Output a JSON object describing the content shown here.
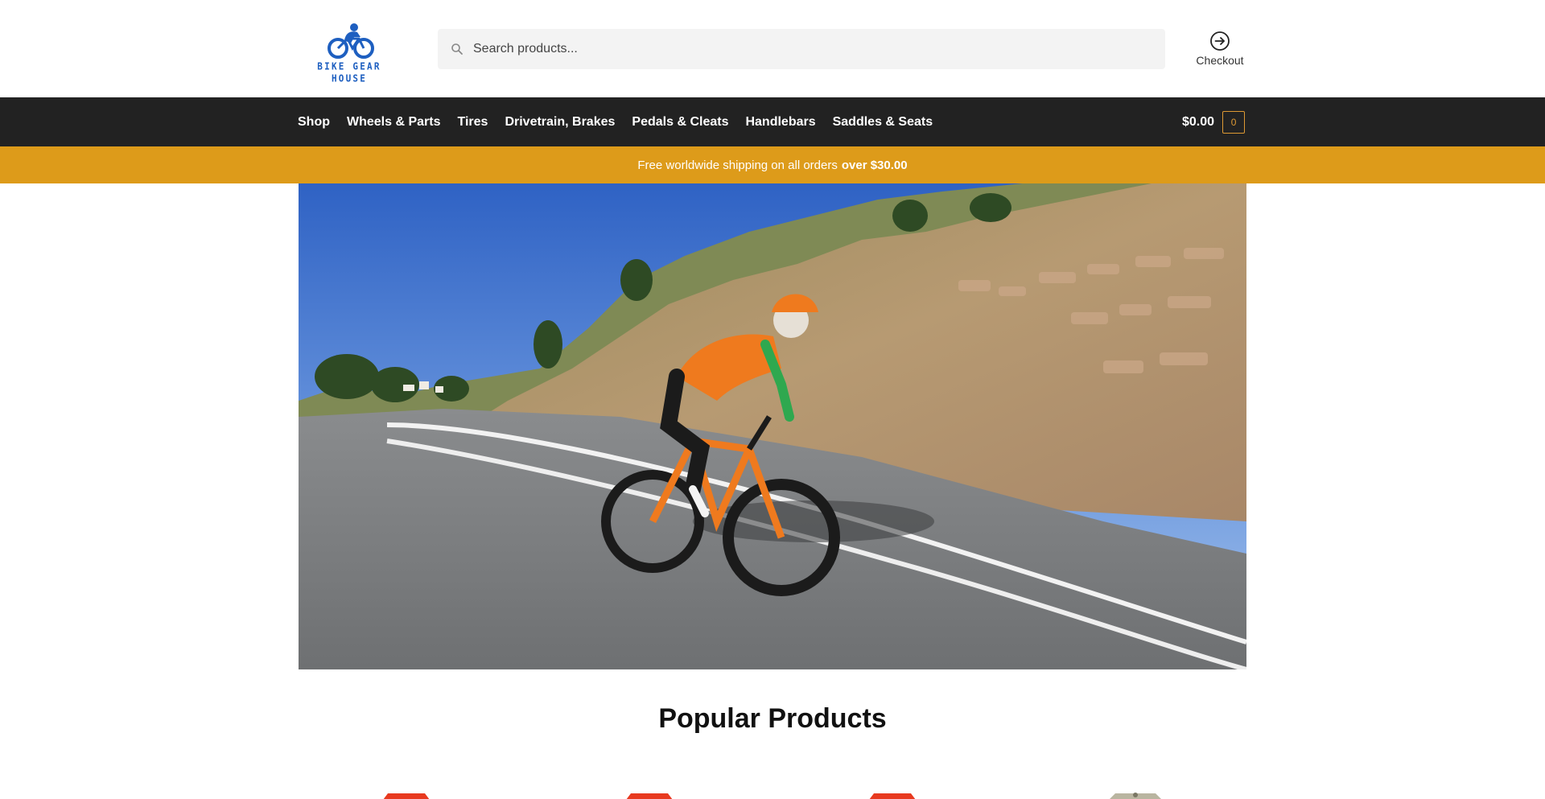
{
  "brand": {
    "name": "BIKE GEAR HOUSE",
    "accent": "#1e5fc0"
  },
  "search": {
    "placeholder": "Search products..."
  },
  "header": {
    "checkout_label": "Checkout"
  },
  "nav": {
    "items": [
      {
        "label": "Shop"
      },
      {
        "label": "Wheels & Parts"
      },
      {
        "label": "Tires"
      },
      {
        "label": "Drivetrain, Brakes"
      },
      {
        "label": "Pedals & Cleats"
      },
      {
        "label": "Handlebars"
      },
      {
        "label": "Saddles & Seats"
      }
    ],
    "background": "#222222"
  },
  "cart": {
    "total": "$0.00",
    "count": "0"
  },
  "promo": {
    "text": "Free worldwide shipping on all orders",
    "highlight": "over $30.00",
    "color": "#dd9b1a"
  },
  "hero": {
    "alt_icon": "cyclist-road-photo"
  },
  "popular": {
    "title": "Popular Products",
    "products": [
      {
        "color": "#e8391f"
      },
      {
        "color": "#e8391f"
      },
      {
        "color": "#e8391f"
      },
      {
        "color": "#b9b5a0"
      }
    ]
  },
  "icons": {
    "search": "search-icon",
    "checkout": "arrow-circle-right-icon",
    "logo": "cyclist-logo-icon"
  }
}
